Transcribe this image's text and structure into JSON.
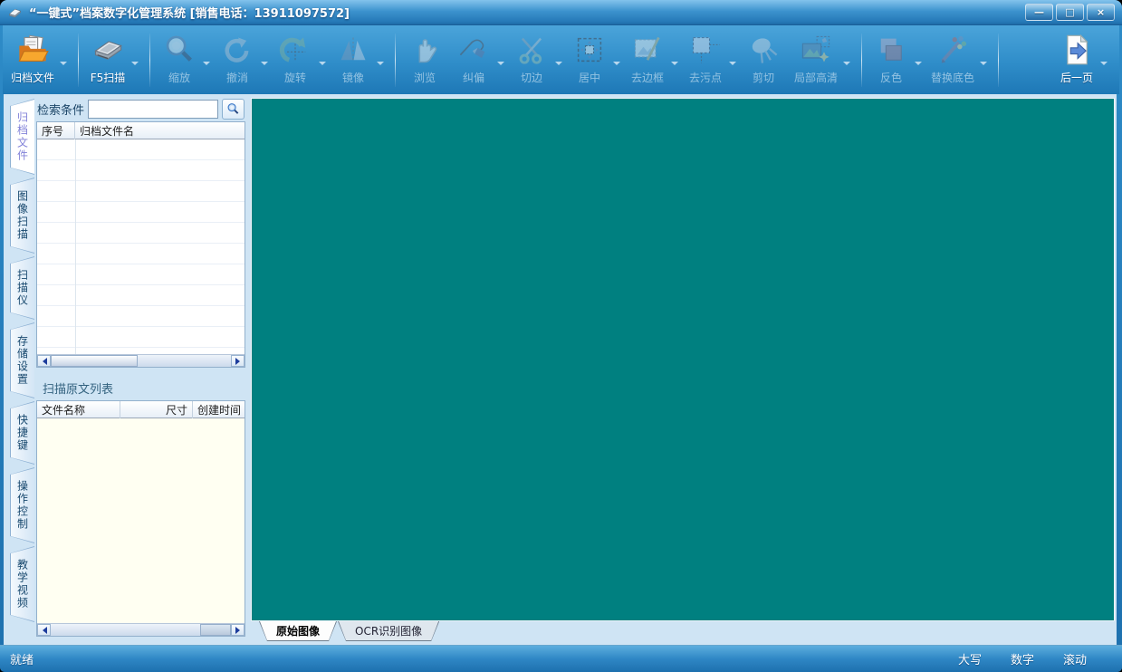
{
  "window": {
    "title": "“一键式”档案数字化管理系统  [销售电话：13911097572]",
    "controls": {
      "minimize": "—",
      "maximize": "□",
      "close": "×"
    }
  },
  "toolbar": {
    "buttons": [
      {
        "name": "archive-files-button",
        "label": "归档文件",
        "icon": "icon-archive-folder",
        "enabled": true,
        "arrow": true,
        "sep_after": true
      },
      {
        "name": "scan-f5-button",
        "label": "F5扫描",
        "icon": "icon-scanner",
        "enabled": true,
        "arrow": true,
        "sep_after": true
      },
      {
        "name": "zoom-button",
        "label": "缩放",
        "icon": "icon-zoom",
        "enabled": false,
        "arrow": true
      },
      {
        "name": "undo-button",
        "label": "撤消",
        "icon": "icon-undo",
        "enabled": false,
        "arrow": true
      },
      {
        "name": "rotate-button",
        "label": "旋转",
        "icon": "icon-rotate",
        "enabled": false,
        "arrow": true
      },
      {
        "name": "mirror-button",
        "label": "镜像",
        "icon": "icon-mirror",
        "enabled": false,
        "arrow": true,
        "sep_after": true
      },
      {
        "name": "browse-button",
        "label": "浏览",
        "icon": "icon-hand",
        "enabled": false,
        "arrow": false
      },
      {
        "name": "deskew-button",
        "label": "纠偏",
        "icon": "icon-deskew",
        "enabled": false,
        "arrow": true
      },
      {
        "name": "crop-edge-button",
        "label": "切边",
        "icon": "icon-scissors",
        "enabled": false,
        "arrow": true
      },
      {
        "name": "center-button",
        "label": "居中",
        "icon": "icon-center",
        "enabled": false,
        "arrow": true
      },
      {
        "name": "remove-border-button",
        "label": "去边框",
        "icon": "icon-remove-border",
        "enabled": false,
        "arrow": true
      },
      {
        "name": "remove-stain-button",
        "label": "去污点",
        "icon": "icon-remove-stain",
        "enabled": false,
        "arrow": true
      },
      {
        "name": "cut-button",
        "label": "剪切",
        "icon": "icon-cut",
        "enabled": false,
        "arrow": false
      },
      {
        "name": "partial-hd-button",
        "label": "局部高清",
        "icon": "icon-partial-hd",
        "enabled": false,
        "arrow": true,
        "sep_after": true
      },
      {
        "name": "invert-color-button",
        "label": "反色",
        "icon": "icon-invert",
        "enabled": false,
        "arrow": true
      },
      {
        "name": "replace-bg-button",
        "label": "替换底色",
        "icon": "icon-replace-bg",
        "enabled": false,
        "arrow": true,
        "sep_after": true
      },
      {
        "name": "next-page-button",
        "label": "后一页",
        "icon": "icon-next-page",
        "enabled": true,
        "arrow": true
      }
    ]
  },
  "sidebar": {
    "tabs": [
      {
        "name": "tab-archive-files",
        "label": "归档文件",
        "active": true
      },
      {
        "name": "tab-image-scan",
        "label": "图像扫描"
      },
      {
        "name": "tab-scanner",
        "label": "扫描仪"
      },
      {
        "name": "tab-storage-settings",
        "label": "存储设置"
      },
      {
        "name": "tab-hotkeys",
        "label": "快捷键"
      },
      {
        "name": "tab-operation-control",
        "label": "操作控制"
      },
      {
        "name": "tab-tutorial-videos",
        "label": "教学视频"
      }
    ]
  },
  "search": {
    "label": "检索条件",
    "value": "",
    "placeholder": ""
  },
  "archive_table": {
    "columns": [
      "序号",
      "归档文件名"
    ],
    "rows": []
  },
  "scan_list": {
    "title": "扫描原文列表",
    "columns": [
      "文件名称",
      "尺寸",
      "创建时间"
    ],
    "rows": []
  },
  "viewer": {
    "tabs": [
      {
        "name": "tab-original-image",
        "label": "原始图像",
        "active": true
      },
      {
        "name": "tab-ocr-image",
        "label": "OCR识别图像"
      }
    ],
    "canvas_color": "#008080"
  },
  "statusbar": {
    "status": "就绪",
    "indicators": [
      "大写",
      "数字",
      "滚动"
    ]
  },
  "colors": {
    "canvas_teal": "#008080",
    "titlebar_blue": "#3d93ce",
    "panel_blue": "#cfe4f4",
    "list_cream": "#fffff2"
  }
}
